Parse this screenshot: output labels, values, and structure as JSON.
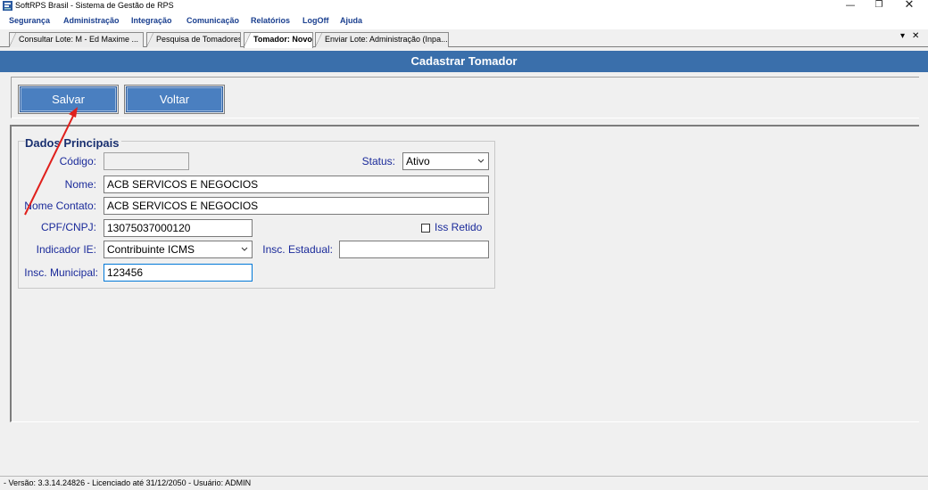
{
  "window": {
    "title": "SoftRPS Brasil - Sistema de Gestão de RPS",
    "minimize_glyph": "—",
    "restore_glyph": "❐",
    "close_glyph": "✕"
  },
  "menu": {
    "items": [
      {
        "label": "Segurança"
      },
      {
        "label": "Administração"
      },
      {
        "label": "Integração"
      },
      {
        "label": "Comunicação"
      },
      {
        "label": "Relatórios"
      },
      {
        "label": "LogOff"
      },
      {
        "label": "Ajuda"
      }
    ]
  },
  "tabs": [
    {
      "label": "Consultar Lote: M - Ed Maxime ...",
      "active": false
    },
    {
      "label": "Pesquisa de Tomadores",
      "active": false
    },
    {
      "label": "Tomador: Novo",
      "active": true
    },
    {
      "label": "Enviar Lote: Administração (Inpa...",
      "active": false
    }
  ],
  "tab_controls": {
    "dropdown": "▾",
    "close": "✕"
  },
  "page": {
    "header": "Cadastrar Tomador"
  },
  "toolbar": {
    "save_label": "Salvar",
    "back_label": "Voltar"
  },
  "form": {
    "group_title": "Dados Principais",
    "codigo": {
      "label": "Código:",
      "value": ""
    },
    "status": {
      "label": "Status:",
      "value": "Ativo"
    },
    "nome": {
      "label": "Nome:",
      "value": "ACB SERVICOS E NEGOCIOS"
    },
    "nome_contato": {
      "label": "Nome Contato:",
      "value": "ACB SERVICOS E NEGOCIOS"
    },
    "cpf_cnpj": {
      "label": "CPF/CNPJ:",
      "value": "13075037000120"
    },
    "iss_retido": {
      "label": "Iss Retido",
      "checked": false
    },
    "indicador_ie": {
      "label": "Indicador IE:",
      "value": "Contribuinte ICMS"
    },
    "insc_estadual": {
      "label": "Insc. Estadual:",
      "value": ""
    },
    "insc_municipal": {
      "label": "Insc. Municipal:",
      "value": "123456"
    }
  },
  "statusbar": {
    "text": "- Versão: 3.3.14.24826 - Licenciado até 31/12/2050 - Usuário: ADMIN"
  },
  "colors": {
    "accent": "#3a6fab",
    "button": "#4a7fc0",
    "label": "#1a2a9a",
    "annotation": "#e0201c"
  }
}
